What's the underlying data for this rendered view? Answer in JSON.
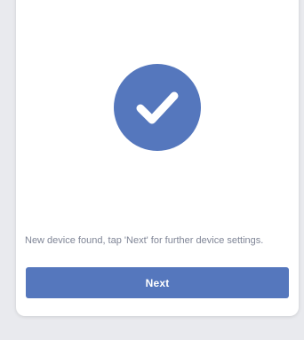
{
  "status": {
    "icon": "checkmark-icon",
    "message": "New device found, tap 'Next' for further device settings."
  },
  "actions": {
    "next_label": "Next"
  },
  "colors": {
    "accent": "#5577bd",
    "background": "#e9eaee",
    "card": "#ffffff",
    "message_text": "#7f8596"
  }
}
